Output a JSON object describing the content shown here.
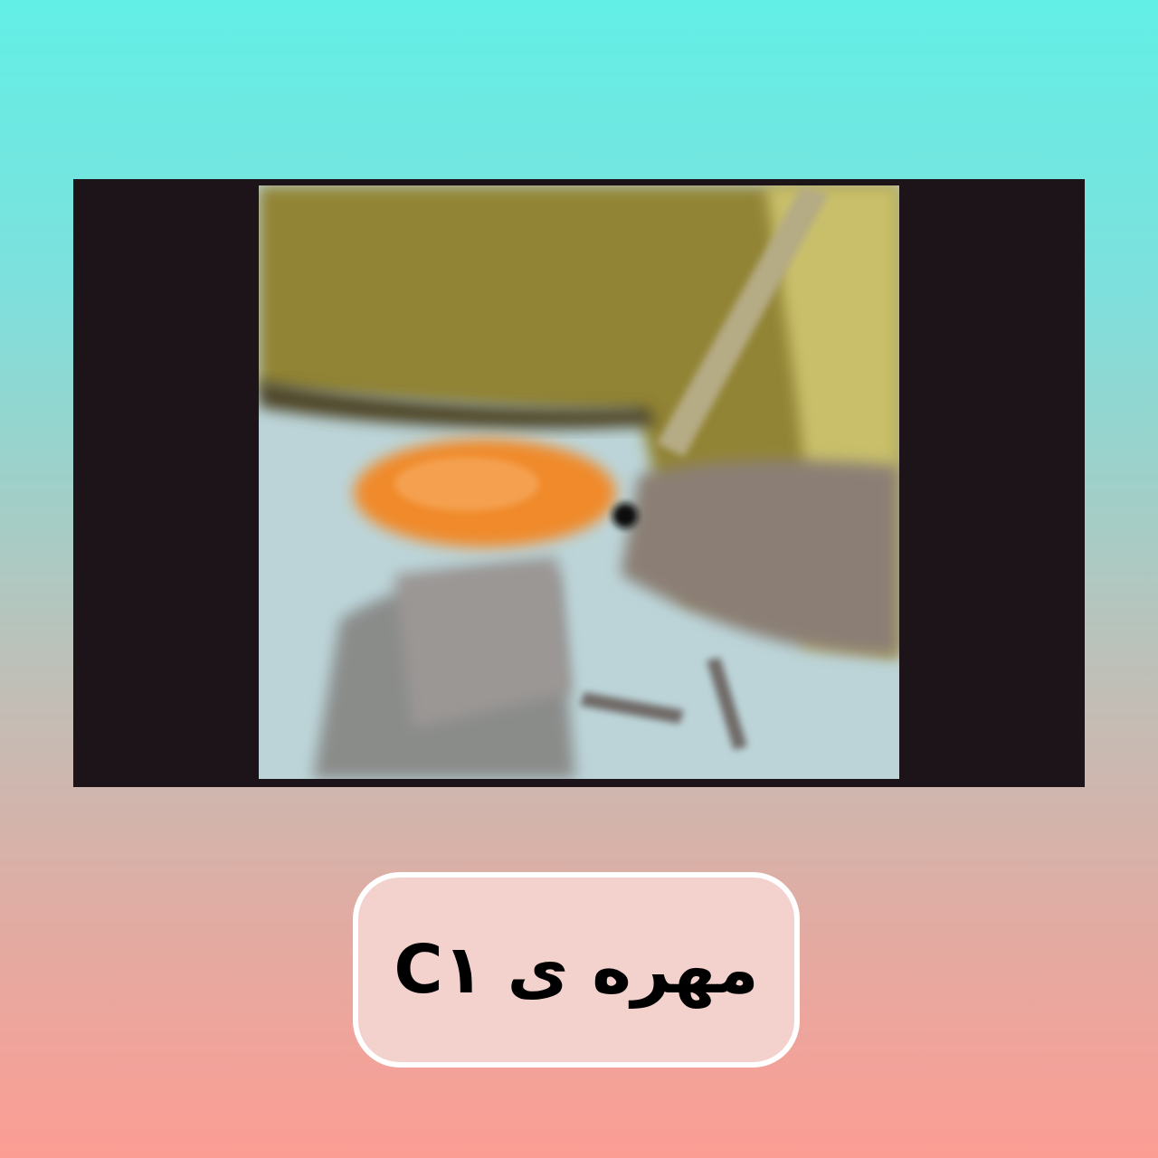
{
  "caption": {
    "text": "مهره ی C۱"
  },
  "video": {
    "icon": "xray-image"
  }
}
